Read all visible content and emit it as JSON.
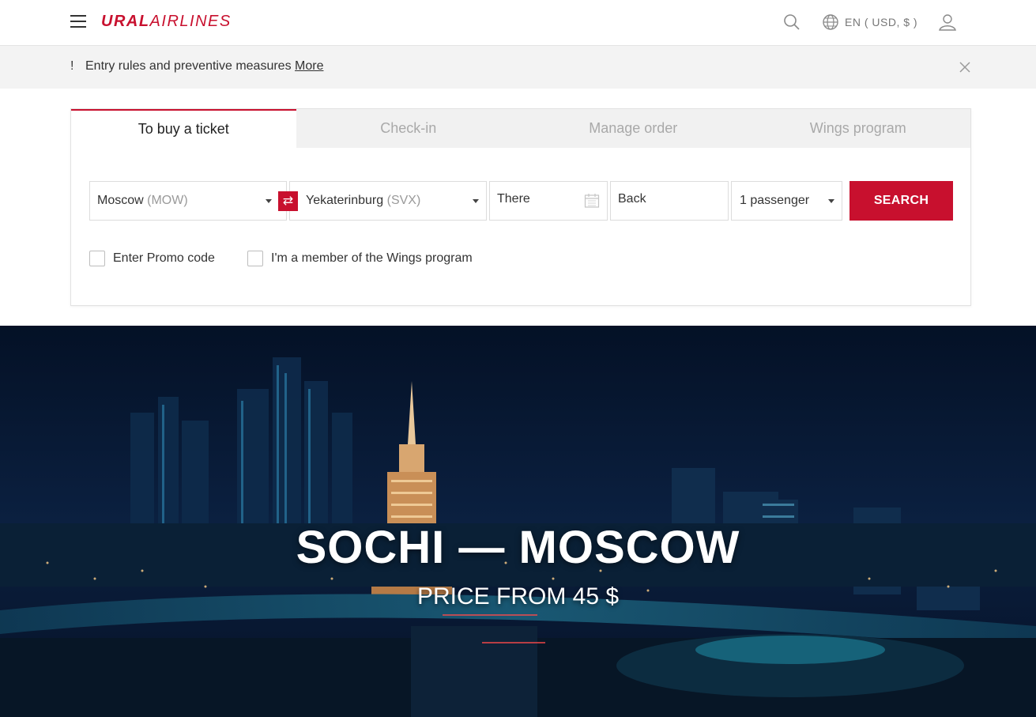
{
  "header": {
    "logo_bold": "URAL",
    "logo_light": "AIRLINES",
    "lang_label": "EN ( USD, $ )"
  },
  "notice": {
    "mark": "!",
    "text": "Entry rules and preventive measures ",
    "link": "More"
  },
  "tabs": [
    {
      "label": "To buy a ticket",
      "active": true
    },
    {
      "label": "Check-in",
      "active": false
    },
    {
      "label": "Manage order",
      "active": false
    },
    {
      "label": "Wings program",
      "active": false
    }
  ],
  "search_form": {
    "from_city": "Moscow",
    "from_code": "(MOW)",
    "to_city": "Yekaterinburg",
    "to_code": "(SVX)",
    "swap_icon": "⇄",
    "date_there": "There",
    "date_back": "Back",
    "passengers": "1 passenger",
    "search_label": "SEARCH",
    "promo_label": "Enter Promo code",
    "wings_member_label": "I'm a member of the Wings program"
  },
  "hero": {
    "title": "SOCHI — MOSCOW",
    "subtitle": "PRICE FROM 45 $"
  },
  "colors": {
    "brand": "#c8102e",
    "hero_bg": "#0a1d3a"
  }
}
